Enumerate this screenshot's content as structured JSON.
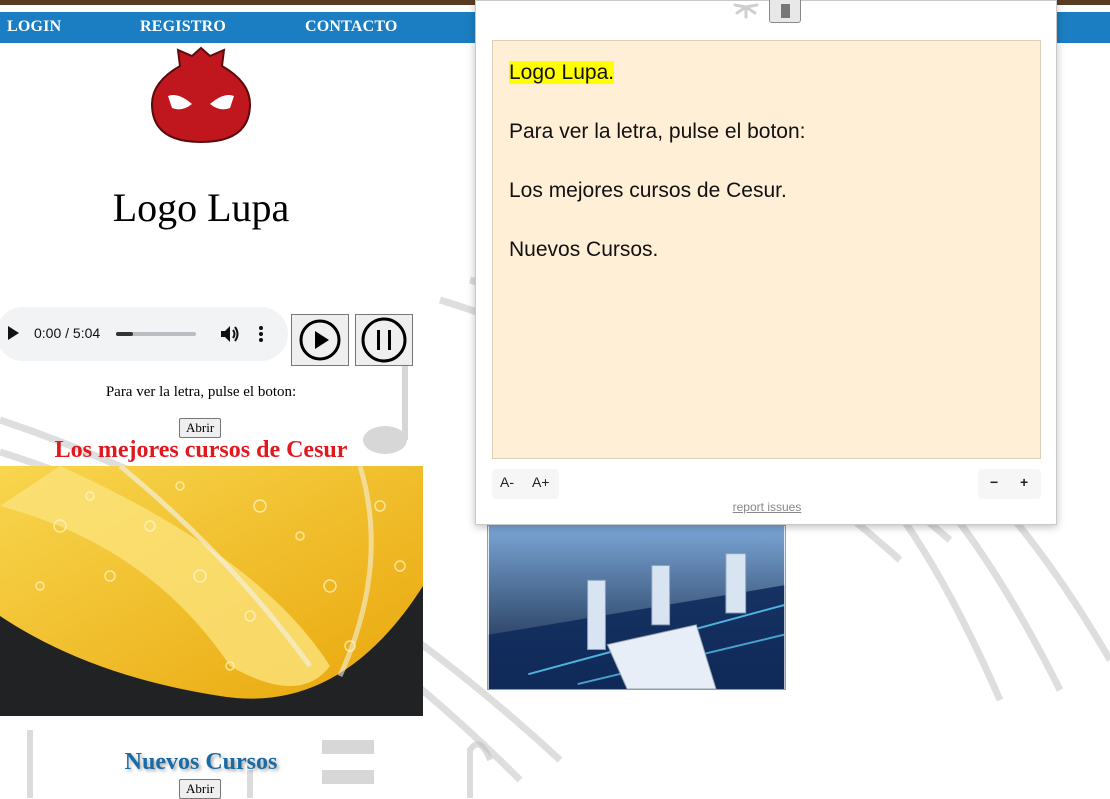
{
  "nav": {
    "login": "LOGIN",
    "registro": "REGISTRO",
    "contacto": "CONTACTO"
  },
  "site": {
    "title": "Logo Lupa",
    "lyrics_hint": "Para ver la letra, pulse el boton:",
    "abrir_label": "Abrir",
    "section_courses": "Los mejores cursos de Cesur",
    "section_new": "Nuevos Cursos",
    "abrir2_label": "Abrir"
  },
  "audio": {
    "time": "0:00 / 5:04",
    "progress": 0.21
  },
  "icons": {
    "play": "play-circle-icon",
    "pause": "pause-circle-icon",
    "logo": "red-mask-logo",
    "spinner": "loading-spinner-icon",
    "stop": "stop-icon"
  },
  "reader": {
    "line1": "Logo Lupa.",
    "line2": "Para ver la letra, pulse el boton:",
    "line3": "Los mejores cursos de Cesur.",
    "line4": "Nuevos Cursos.",
    "font_minus": "A-",
    "font_plus": "A+",
    "zoom_minus": "−",
    "zoom_plus": "+",
    "report": "report issues"
  },
  "colors": {
    "nav": "#1b7ec2",
    "red_heading": "#e0191e",
    "blue_heading": "#1a6aa3",
    "reader_bg": "#ffefd6",
    "highlight": "#ffff00"
  }
}
